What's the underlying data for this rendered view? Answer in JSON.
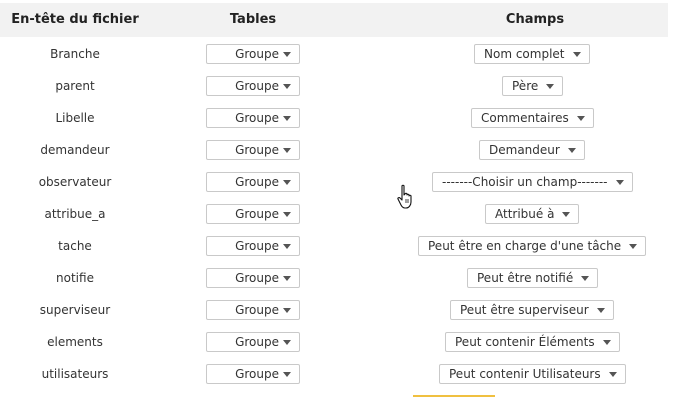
{
  "header": {
    "col_file": "En-tête du fichier",
    "col_tables": "Tables",
    "col_fields": "Champs"
  },
  "rows": [
    {
      "label": "Branche",
      "table": "Groupe",
      "field": "Nom complet"
    },
    {
      "label": "parent",
      "table": "Groupe",
      "field": "Père"
    },
    {
      "label": "Libelle",
      "table": "Groupe",
      "field": "Commentaires"
    },
    {
      "label": "demandeur",
      "table": "Groupe",
      "field": "Demandeur"
    },
    {
      "label": "observateur",
      "table": "Groupe",
      "field": "-------Choisir un champ-------"
    },
    {
      "label": "attribue_a",
      "table": "Groupe",
      "field": "Attribué à"
    },
    {
      "label": "tache",
      "table": "Groupe",
      "field": "Peut être en charge d'une tâche"
    },
    {
      "label": "notifie",
      "table": "Groupe",
      "field": "Peut être notifié"
    },
    {
      "label": "superviseur",
      "table": "Groupe",
      "field": "Peut être superviseur"
    },
    {
      "label": "elements",
      "table": "Groupe",
      "field": "Peut contenir Éléments"
    },
    {
      "label": "utilisateurs",
      "table": "Groupe",
      "field": "Peut contenir Utilisateurs"
    }
  ],
  "icons": {
    "cursor": "hand-pointer-icon",
    "dropdown": "chevron-down-icon"
  },
  "colors": {
    "header_bg": "#f2f2f2",
    "border": "#c9c9c9",
    "accent": "#f0c040"
  }
}
